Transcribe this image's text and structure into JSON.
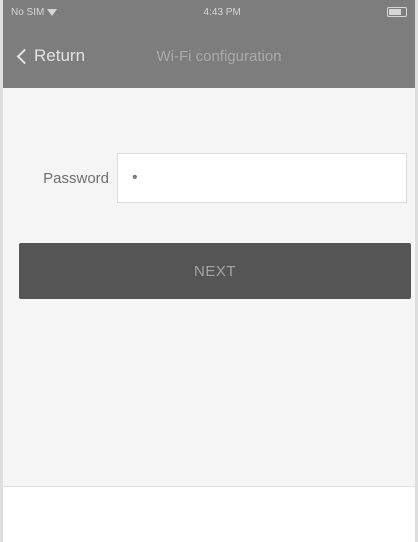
{
  "status_bar": {
    "carrier": "No SIM",
    "time": "4:43 PM",
    "battery_level": 0.85
  },
  "nav": {
    "back_label": "Return",
    "title": "Wi-Fi configuration"
  },
  "form": {
    "password_label": "Password",
    "password_value": "•"
  },
  "actions": {
    "next_label": "NEXT"
  },
  "colors": {
    "nav_background": "#7d7d7d",
    "button_background": "#555555",
    "page_background": "#f5f5f5"
  }
}
